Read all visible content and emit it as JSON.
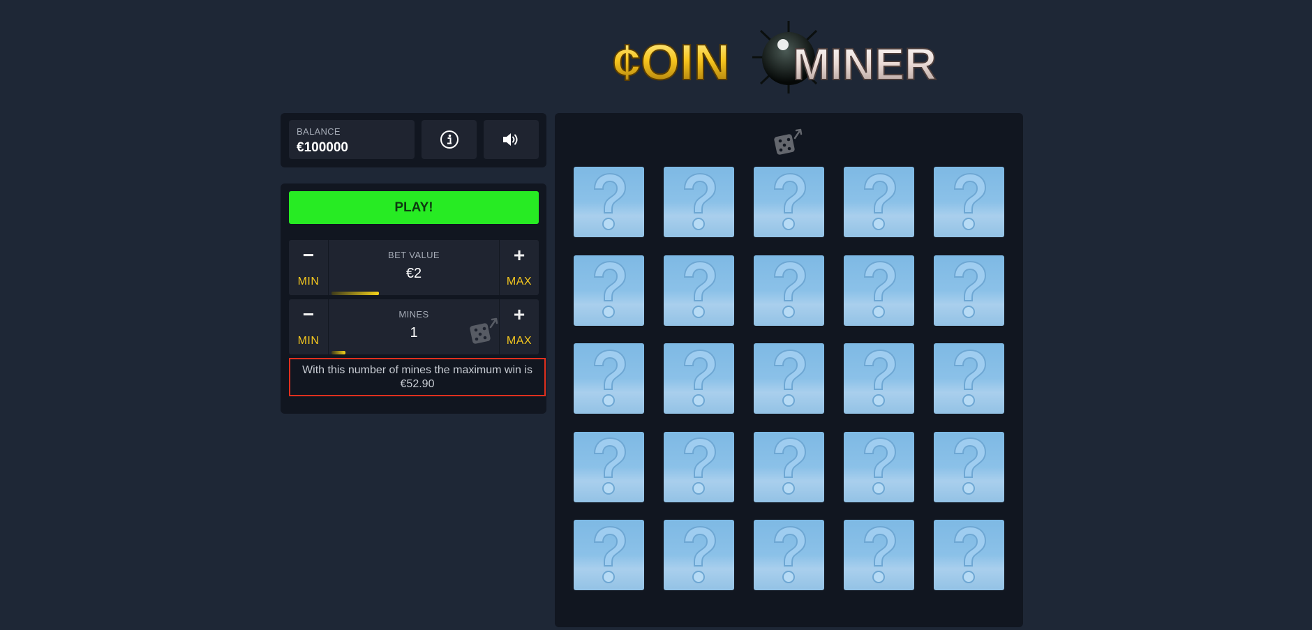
{
  "logo": {
    "coin_text": "¢OIN",
    "miner_text": "MINER"
  },
  "balance": {
    "label": "BALANCE",
    "value": "€100000"
  },
  "icons": {
    "info": "info-icon",
    "sound": "speaker-icon",
    "dice": "dice-random-icon",
    "tile": "question-mark-icon"
  },
  "play_label": "PLAY!",
  "bet": {
    "label": "BET VALUE",
    "value": "€2",
    "minus": "−",
    "plus": "+",
    "min_label": "MIN",
    "max_label": "MAX",
    "level_percent": 28
  },
  "mines": {
    "label": "MINES",
    "value": "1",
    "minus": "−",
    "plus": "+",
    "min_label": "MIN",
    "max_label": "MAX",
    "level_percent": 8
  },
  "max_win_text": "With this number of mines the maximum win is €52.90",
  "grid": {
    "rows": 5,
    "cols": 5,
    "tile_symbol": "?"
  },
  "colors": {
    "background": "#1e2736",
    "panel": "#111620",
    "play": "#27eb23",
    "accent_yellow": "#f3c61f",
    "highlight_border": "#e0301e",
    "tile": "#8bc1e8"
  }
}
